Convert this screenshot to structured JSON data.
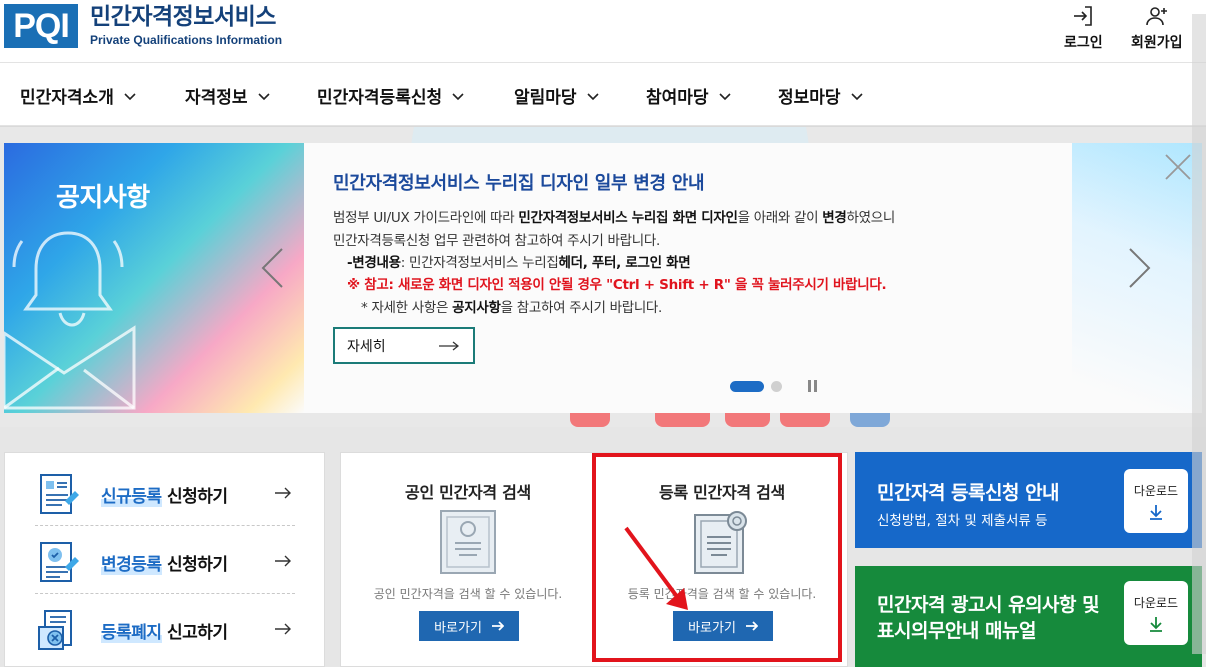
{
  "header": {
    "logo_mark": "PQI",
    "logo_kr": "민간자격정보서비스",
    "logo_en": "Private Qualifications Information",
    "login_label": "로그인",
    "signup_label": "회원가입"
  },
  "nav": {
    "items": [
      "민간자격소개",
      "자격정보",
      "민간자격등록신청",
      "알림마당",
      "참여마당",
      "정보마당"
    ]
  },
  "banner": {
    "badge": "공지사항",
    "heading": "민간자격정보서비스 누리집 디자인 일부 변경 안내",
    "line1_a": "범정부 UI/UX 가이드라인에 따라 ",
    "line1_b": "민간자격정보서비스 누리집 화면 디자인",
    "line1_c": "을 아래와 같이 ",
    "line1_d": "변경",
    "line1_e": "하였으니",
    "line2": "민간자격등록신청 업무 관련하여 참고하여 주시기 바랍니다.",
    "line3_a": "-변경내용",
    "line3_b": ": 민간자격정보서비스 누리집",
    "line3_c": "헤더, 푸터, 로그인 화면",
    "line4": "※ 참고: 새로운 화면 디자인 적용이 안될 경우 \"Ctrl + Shift + R\" 을 꼭 눌러주시기 바랍니다.",
    "line5_a": "* 자세한 사항은 ",
    "line5_b": "공지사항",
    "line5_c": "을 참고하여 주시기 바랍니다.",
    "detail_label": "자세히"
  },
  "registration": [
    {
      "highlight": "신규등록",
      "rest": " 신청하기"
    },
    {
      "highlight": "변경등록",
      "rest": " 신청하기"
    },
    {
      "highlight": "등록폐지",
      "rest": " 신고하기"
    }
  ],
  "search": {
    "official": {
      "title": "공인 민간자격 검색",
      "desc": "공인 민간자격을 검색 할 수 있습니다.",
      "button": "바로가기"
    },
    "registered": {
      "title": "등록 민간자격 검색",
      "desc": "등록 민간자격을 검색 할 수 있습니다.",
      "button": "바로가기"
    }
  },
  "info": {
    "guide": {
      "title": "민간자격 등록신청 안내",
      "sub": "신청방법, 절차 및 제출서류 등",
      "download": "다운로드"
    },
    "manual": {
      "title_1": "민간자격 광고시 유의사항 및",
      "title_2": "표시의무안내 매뉴얼",
      "download": "다운로드"
    }
  },
  "colors": {
    "brand_blue": "#1a6fb5",
    "accent_blue": "#1668c9",
    "accent_green": "#168a3c",
    "alert_red": "#e2141c"
  }
}
